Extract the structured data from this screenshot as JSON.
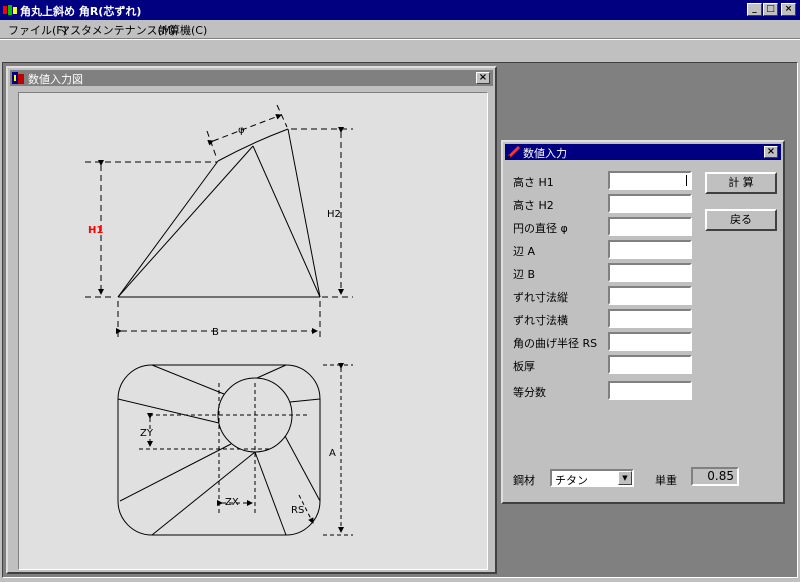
{
  "app": {
    "title": "角丸上斜め 角R(芯ずれ)",
    "window_buttons": [
      "_",
      "□",
      "×"
    ]
  },
  "menu": [
    {
      "label": "ファイル(F)"
    },
    {
      "label": "マスタメンテナンス(M)"
    },
    {
      "label": "計算機(C)"
    }
  ],
  "figure_window": {
    "title": "数値入力図",
    "close": "×",
    "labels": {
      "h1": "H1",
      "h2": "H2",
      "phi": "φ",
      "b": "B",
      "a": "A",
      "zy": "ZY",
      "zx": "ZX",
      "rs": "RS"
    }
  },
  "input_window": {
    "title": "数値入力",
    "close": "×",
    "fields": [
      {
        "label": "高さ H1",
        "value": ""
      },
      {
        "label": "高さ H2",
        "value": ""
      },
      {
        "label": "円の直径 φ",
        "value": ""
      },
      {
        "label": "辺 A",
        "value": ""
      },
      {
        "label": "辺 B",
        "value": ""
      },
      {
        "label": "ずれ寸法縦",
        "value": ""
      },
      {
        "label": "ずれ寸法横",
        "value": ""
      },
      {
        "label": "角の曲げ半径 RS",
        "value": ""
      },
      {
        "label": "板厚",
        "value": ""
      },
      {
        "label": "等分数",
        "value": ""
      }
    ],
    "calc_button": "計 算",
    "back_button": "戻る",
    "material_label": "鋼材",
    "material_value": "チタン",
    "weight_label": "単重",
    "weight_value": "0.85"
  },
  "colors": {
    "title_active": "#000080",
    "highlight_label": "#ff0000"
  }
}
